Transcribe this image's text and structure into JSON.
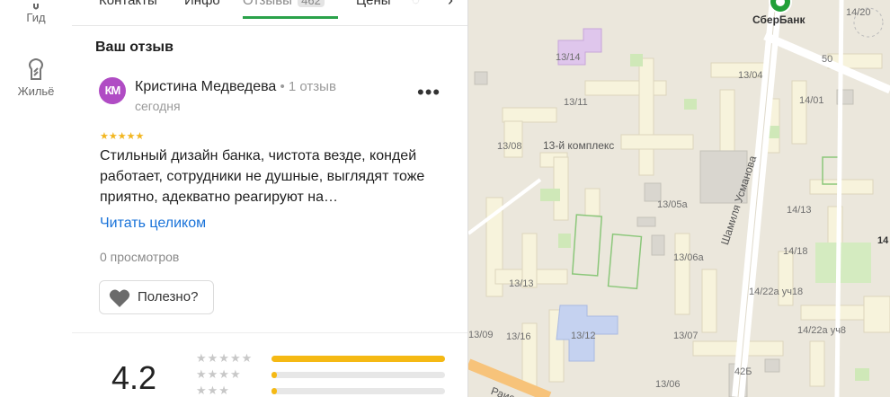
{
  "rail": {
    "items": [
      {
        "label": "Гид",
        "icon": "guide-icon"
      },
      {
        "label": "Жильё",
        "icon": "housing-icon"
      }
    ]
  },
  "tabs": {
    "items": [
      {
        "label": "Контакты"
      },
      {
        "label": "Инфо"
      },
      {
        "label": "Отзывы",
        "count": "462",
        "active": true
      },
      {
        "label": "Цены"
      }
    ]
  },
  "review": {
    "section_title": "Ваш отзыв",
    "avatar_initials": "КМ",
    "avatar_color": "#b04cc4",
    "author": "Кристина Медведева",
    "author_meta": " • 1 отзыв",
    "date": "сегодня",
    "rating_stars": "★★★★★",
    "rating": 5,
    "text": "Стильный дизайн банка, чистота везде, кондей работает, сотрудники не душные, выглядят тоже приятно, адекватно реагируют на…",
    "read_more": "Читать целиком",
    "views": "0 просмотров",
    "useful_label": "Полезно?",
    "more_label": "•••"
  },
  "summary": {
    "rating_value": "4.2",
    "distribution": [
      {
        "stars": "★★★★★",
        "fraction": 1.0
      },
      {
        "stars": "★★★★",
        "fraction": 0.03
      },
      {
        "stars": "★★★",
        "fraction": 0.03
      }
    ],
    "bar_color": "#f5b914"
  },
  "map": {
    "poi": "СберБанк",
    "district": "13-й комплекс",
    "street": "Шамиля Усманова",
    "bottom_street": "Раисо",
    "buildings": [
      "14/20",
      "13/14",
      "50",
      "13/04",
      "14/01",
      "13/11",
      "13/08",
      "13/05а",
      "14/13",
      "14/18",
      "13/06а",
      "13/13",
      "14/22а уч18",
      "13/09",
      "13/16",
      "13/12",
      "13/07",
      "14/22а уч8",
      "42Б",
      "13/06",
      "14"
    ]
  }
}
